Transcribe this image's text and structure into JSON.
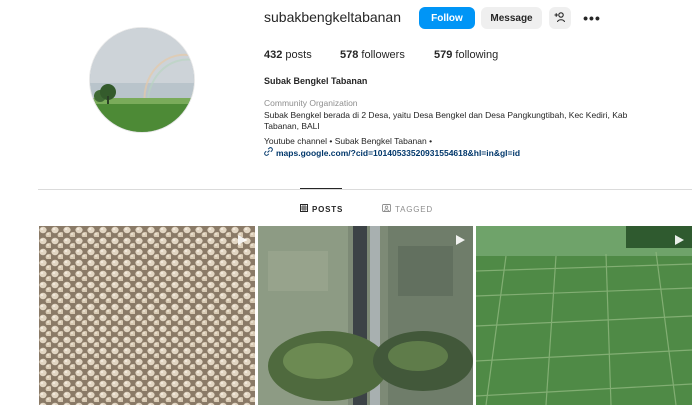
{
  "profile": {
    "username": "subakbengkeltabanan",
    "full_name": "Subak Bengkel Tabanan",
    "category": "Community Organization",
    "bio_lines": [
      "Subak Bengkel berada di 2 Desa, yaitu Desa Bengkel dan Desa Pangkungtibah, Kec Kediri, Kab",
      "Tabanan, BALI"
    ],
    "bio_links_line": "Youtube channel • Subak Bengkel Tabanan •",
    "map_link": "maps.google.com/?cid=10140533520931554618&hl=in&gl=id"
  },
  "actions": {
    "follow_label": "Follow",
    "message_label": "Message",
    "add_user_icon": "add-user-icon",
    "more_icon": "more-options-icon",
    "follow_color": "#0095f6"
  },
  "stats": {
    "posts_count": "432",
    "posts_label": " posts",
    "followers_count": "578",
    "followers_label": " followers",
    "following_count": "579",
    "following_label": " following"
  },
  "tabs": [
    {
      "label": "POSTS",
      "icon": "grid-icon",
      "active": true
    },
    {
      "label": "TAGGED",
      "icon": "tag-icon",
      "active": false
    }
  ],
  "posts": [
    {
      "subject": "soybeans",
      "type": "reel"
    },
    {
      "subject": "aerial-canal-palm-trees",
      "type": "reel"
    },
    {
      "subject": "aerial-rice-fields",
      "type": "reel"
    }
  ]
}
